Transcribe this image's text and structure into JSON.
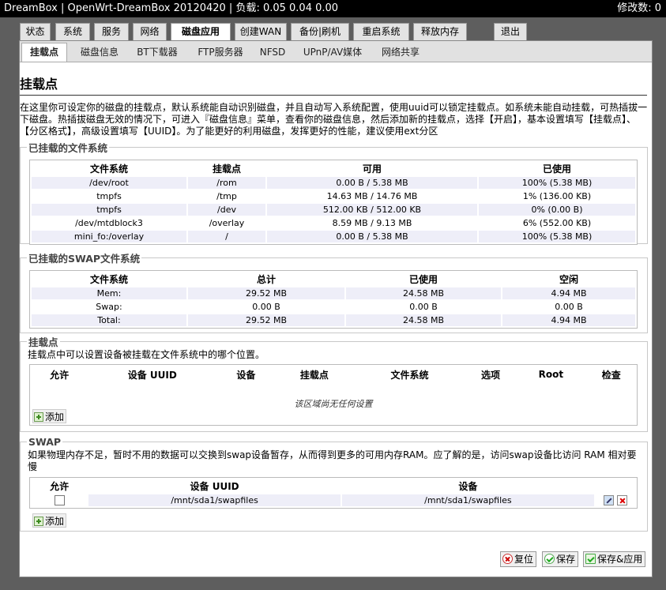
{
  "header": {
    "title_left": "DreamBox | OpenWrt-DreamBox 20120420 | 负载: 0.05 0.04 0.00",
    "changes": "修改数: 0"
  },
  "main_tabs": [
    "状态",
    "系统",
    "服务",
    "网络",
    "磁盘应用",
    "创建WAN",
    "备份|刷机",
    "重启系统",
    "释放内存",
    "退出"
  ],
  "main_tab_active": "磁盘应用",
  "sub_tabs": [
    "挂载点",
    "磁盘信息",
    "BT下载器",
    "FTP服务器",
    "NFSD",
    "UPnP/AV媒体",
    "网络共享"
  ],
  "sub_tab_active": "挂载点",
  "page_title": "挂载点",
  "intro": "在这里你可设定你的磁盘的挂载点，默认系统能自动识别磁盘，并且自动写入系统配置，使用uuid可以锁定挂载点。如系统未能自动挂载，可热插拔一下磁盘。热插拔磁盘无效的情况下，可进入『磁盘信息』菜单，查看你的磁盘信息，然后添加新的挂载点，选择【开启】，基本设置填写【挂载点】、【分区格式】，高级设置填写【UUID】。为了能更好的利用磁盘，发挥更好的性能，建议使用ext分区",
  "mounted_fs": {
    "legend": "已挂载的文件系统",
    "headers": [
      "文件系统",
      "挂载点",
      "可用",
      "已使用"
    ],
    "rows": [
      [
        "/dev/root",
        "/rom",
        "0.00 B / 5.38 MB",
        "100% (5.38 MB)"
      ],
      [
        "tmpfs",
        "/tmp",
        "14.63 MB / 14.76 MB",
        "1% (136.00 KB)"
      ],
      [
        "tmpfs",
        "/dev",
        "512.00 KB / 512.00 KB",
        "0% (0.00 B)"
      ],
      [
        "/dev/mtdblock3",
        "/overlay",
        "8.59 MB / 9.13 MB",
        "6% (552.00 KB)"
      ],
      [
        "mini_fo:/overlay",
        "/",
        "0.00 B / 5.38 MB",
        "100% (5.38 MB)"
      ]
    ]
  },
  "swap_fs": {
    "legend": "已挂载的SWAP文件系统",
    "headers": [
      "文件系统",
      "总计",
      "已使用",
      "空闲"
    ],
    "rows": [
      [
        "Mem:",
        "29.52 MB",
        "24.58 MB",
        "4.94 MB"
      ],
      [
        "Swap:",
        "0.00 B",
        "0.00 B",
        "0.00 B"
      ],
      [
        "Total:",
        "29.52 MB",
        "24.58 MB",
        "4.94 MB"
      ]
    ]
  },
  "mount_points": {
    "legend": "挂载点",
    "description": "挂载点中可以设置设备被挂载在文件系统中的哪个位置。",
    "headers": [
      "允许",
      "设备 UUID",
      "设备",
      "挂载点",
      "文件系统",
      "选项",
      "Root",
      "检查"
    ],
    "empty_text": "该区域尚无任何设置",
    "add_label": "添加"
  },
  "swap": {
    "legend": "SWAP",
    "description": "如果物理内存不足，暂时不用的数据可以交换到swap设备暂存，从而得到更多的可用内存RAM。应了解的是，访问swap设备比访问 RAM 相对要慢",
    "headers": [
      "允许",
      "设备 UUID",
      "设备"
    ],
    "rows": [
      {
        "enabled": false,
        "uuid": "/mnt/sda1/swapfiles",
        "device": "/mnt/sda1/swapfiles"
      }
    ],
    "add_label": "添加"
  },
  "actions": {
    "reset": "复位",
    "save": "保存",
    "save_apply": "保存&应用"
  }
}
